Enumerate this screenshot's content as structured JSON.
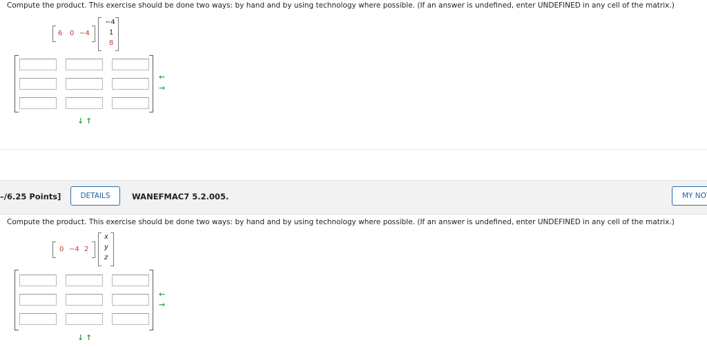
{
  "problem1": {
    "instruction": "Compute the product. This exercise should be done two ways: by hand and by using technology where possible. (If an answer is undefined, enter UNDEFINED in any cell of the matrix.)",
    "row_matrix": [
      "6",
      "0",
      "−4"
    ],
    "column_matrix": [
      "−4",
      "1",
      "8"
    ],
    "answer_grid": {
      "rows": 3,
      "cols": 3
    }
  },
  "problem2": {
    "points": "–/6.25 Points]",
    "details_label": "DETAILS",
    "problem_id": "WANEFMAC7 5.2.005.",
    "my_notes_label": "MY NOTES",
    "instruction": "Compute the product. This exercise should be done two ways: by hand and by using technology where possible. (If an answer is undefined, enter UNDEFINED in any cell of the matrix.)",
    "row_matrix": [
      "0",
      "−4",
      "2"
    ],
    "column_matrix": [
      "x",
      "y",
      "z"
    ],
    "answer_grid": {
      "rows": 3,
      "cols": 3
    }
  },
  "icons": {
    "row_arrows": "left-right-arrows-icon",
    "col_arrows": "down-up-arrows-icon",
    "arrow_color": "#3aa14a"
  }
}
